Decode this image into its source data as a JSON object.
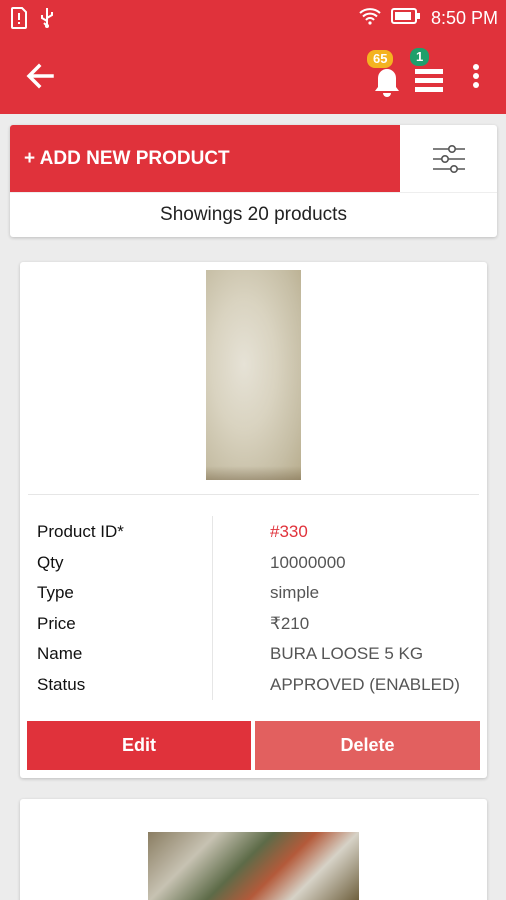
{
  "status_bar": {
    "time": "8:50 PM",
    "icons": [
      "sim-alert-icon",
      "usb-icon",
      "wifi-icon",
      "battery-icon"
    ]
  },
  "app_bar": {
    "back_icon": "arrow-back-icon",
    "notification_count": "65",
    "menu_count": "1",
    "menu_icon": "stacked-menu-icon",
    "more_icon": "more-vertical-icon"
  },
  "top_card": {
    "add_button_label": "+ ADD NEW PRODUCT",
    "filter_icon": "sliders-icon",
    "showing_text": "Showings 20 products"
  },
  "product": {
    "rows": [
      {
        "label": "Product ID*",
        "value": "#330"
      },
      {
        "label": "Qty",
        "value": "10000000"
      },
      {
        "label": "Type",
        "value": "simple"
      },
      {
        "label": "Price",
        "value": "₹210"
      },
      {
        "label": "Name",
        "value": "BURA LOOSE 5 KG"
      },
      {
        "label": "Status",
        "value": "APPROVED (ENABLED)"
      }
    ],
    "edit_label": "Edit",
    "delete_label": "Delete"
  },
  "colors": {
    "primary": "#e0323b",
    "delete_button": "#e2605f",
    "badge_yellow": "#f4b320",
    "badge_green": "#1fa06b"
  }
}
